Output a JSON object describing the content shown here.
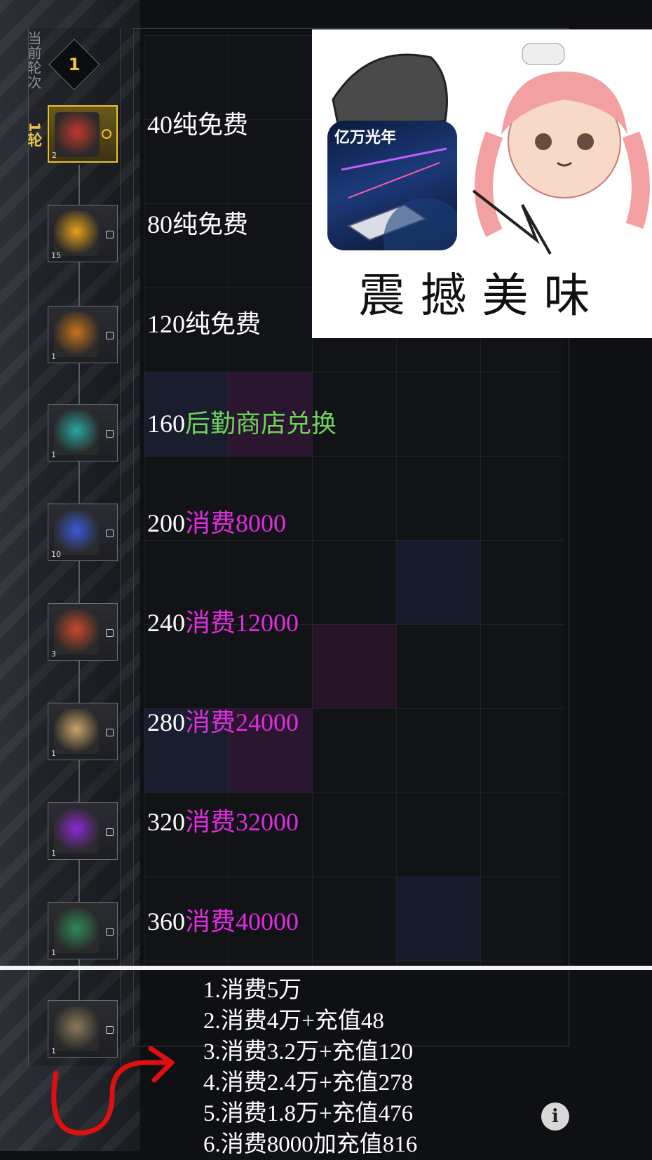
{
  "round": {
    "label": "当前轮次",
    "number": "1",
    "current": "1轮"
  },
  "rewards": [
    {
      "count": "2",
      "selected": true,
      "color": "#c0392b"
    },
    {
      "count": "15",
      "selected": false,
      "color": "#e6a21a"
    },
    {
      "count": "1",
      "selected": false,
      "color": "#c8731c"
    },
    {
      "count": "1",
      "selected": false,
      "color": "#2aa6a0"
    },
    {
      "count": "10",
      "selected": false,
      "color": "#3b5ad6"
    },
    {
      "count": "3",
      "selected": false,
      "color": "#c74a2b"
    },
    {
      "count": "1",
      "selected": false,
      "color": "#c9a46a"
    },
    {
      "count": "1",
      "selected": false,
      "color": "#8a2ad0"
    },
    {
      "count": "1",
      "selected": false,
      "color": "#2f8a55"
    },
    {
      "count": "1",
      "selected": false,
      "color": "#8a7a5a"
    }
  ],
  "tiers": [
    {
      "value": "40",
      "note": "纯免费",
      "note_color": "white"
    },
    {
      "value": "80",
      "note": "纯免费",
      "note_color": "white"
    },
    {
      "value": "120",
      "note": "纯免费",
      "note_color": "white"
    },
    {
      "value": "160",
      "note": "后勤商店兑换",
      "note_color": "green"
    },
    {
      "value": "200",
      "note": "消费8000",
      "note_color": "magenta"
    },
    {
      "value": "240",
      "note": "消费12000",
      "note_color": "magenta"
    },
    {
      "value": "280",
      "note": "消费24000",
      "note_color": "magenta"
    },
    {
      "value": "320",
      "note": "消费32000",
      "note_color": "magenta"
    },
    {
      "value": "360",
      "note": "消费40000",
      "note_color": "magenta"
    }
  ],
  "meme": {
    "caption": "震撼美味",
    "app_title": "亿万光年"
  },
  "rules": [
    "1.消费5万",
    "2.消费4万+充值48",
    "3.消费3.2万+充值120",
    "4.消费2.4万+充值278",
    "5.消费1.8万+充值476",
    "6.消费8000加充值816"
  ],
  "info_icon": "i",
  "colors": {
    "gold": "#e7c12e",
    "green_note": "#6fd35a",
    "magenta_note": "#e22ce0",
    "annotation_red": "#e01010"
  }
}
